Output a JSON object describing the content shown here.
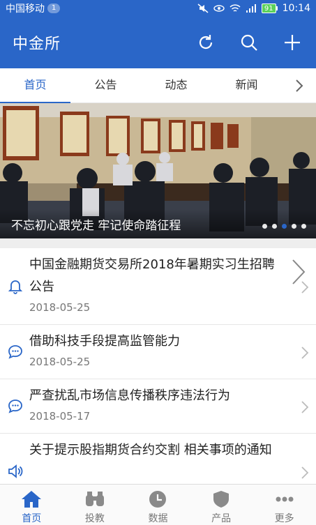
{
  "status_bar": {
    "carrier": "中国移动",
    "carrier_badge": "1",
    "battery": "91",
    "time": "10:14"
  },
  "app_bar": {
    "title": "中金所",
    "icons": [
      "refresh-icon",
      "search-icon",
      "plus-icon"
    ]
  },
  "tabs": {
    "items": [
      {
        "label": "首页",
        "active": true
      },
      {
        "label": "公告",
        "active": false
      },
      {
        "label": "动态",
        "active": false
      },
      {
        "label": "新闻",
        "active": false
      }
    ]
  },
  "banner": {
    "caption": "不忘初心跟党走 牢记使命踏征程",
    "slide_count": 5,
    "active_index": 2
  },
  "news": [
    {
      "icon": "bell-icon",
      "title": "中国金融期货交易所2018年暑期实习生招聘公告",
      "date": "2018-05-25"
    },
    {
      "icon": "chat-icon",
      "title": "借助科技手段提高监管能力",
      "date": "2018-05-25"
    },
    {
      "icon": "chat-icon",
      "title": "严查扰乱市场信息传播秩序违法行为",
      "date": "2018-05-17"
    },
    {
      "icon": "speaker-icon",
      "title": "关于提示股指期货合约交割 相关事项的通知",
      "date": ""
    }
  ],
  "bottom_nav": [
    {
      "label": "首页",
      "icon": "home-icon",
      "active": true
    },
    {
      "label": "投教",
      "icon": "binoculars-icon",
      "active": false
    },
    {
      "label": "数据",
      "icon": "clock-icon",
      "active": false
    },
    {
      "label": "产品",
      "icon": "shield-icon",
      "active": false
    },
    {
      "label": "更多",
      "icon": "more-icon",
      "active": false
    }
  ],
  "colors": {
    "primary": "#2a66c8",
    "battery": "#5bd15b"
  }
}
